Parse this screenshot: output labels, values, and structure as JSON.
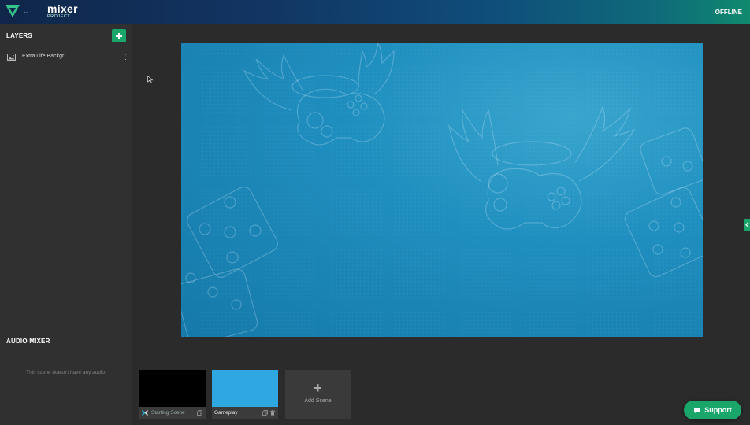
{
  "header": {
    "brand_name": "mixer",
    "brand_sub": "PROJECT",
    "status": "OFFLINE"
  },
  "sidebar": {
    "layers_title": "LAYERS",
    "add_layer_icon": "plus-icon",
    "layers": [
      {
        "name": "Extra Life Backgr...",
        "icon": "image-icon"
      }
    ],
    "audio_title": "AUDIO MIXER",
    "audio_empty": "This scene doesn't have any audio."
  },
  "scenes": [
    {
      "label": "Starting Scene",
      "thumb_color": "#000000",
      "active": true
    },
    {
      "label": "Gameplay",
      "thumb_color": "#2fa7e0",
      "active": false
    }
  ],
  "add_scene": {
    "plus": "+",
    "label": "Add Scene"
  },
  "support": {
    "label": "Support"
  },
  "colors": {
    "accent": "#1aa56a",
    "preview_bg": "#1f8fbf",
    "scene_active_thumb": "#000000",
    "gameplay_thumb": "#2fa7e0"
  }
}
